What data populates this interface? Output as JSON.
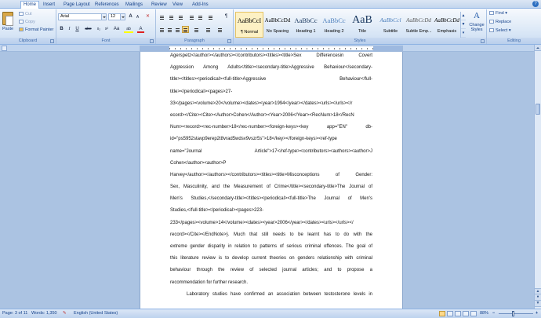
{
  "tabs": [
    "Home",
    "Insert",
    "Page Layout",
    "References",
    "Mailings",
    "Review",
    "View",
    "Add-Ins"
  ],
  "active_tab": "Home",
  "clipboard": {
    "paste": "Paste",
    "cut": "Cut",
    "copy": "Copy",
    "format_painter": "Format Painter",
    "label": "Clipboard"
  },
  "font": {
    "name": "Arial",
    "size": "12",
    "label": "Font",
    "bold": "B",
    "italic": "I",
    "underline": "U",
    "strikethrough": "abe",
    "subscript": "x₂",
    "superscript": "x²",
    "change_case": "Aa",
    "highlight": "ab",
    "font_color": "A",
    "grow": "A",
    "shrink": "A"
  },
  "paragraph": {
    "label": "Paragraph",
    "pilcrow": "¶"
  },
  "styles": {
    "label": "Styles",
    "items": [
      {
        "sample": "AaBbCcI",
        "name": "¶ Normal",
        "selected": true
      },
      {
        "sample": "AaBbCcDd",
        "name": "No Spacing",
        "selected": false
      },
      {
        "sample": "AaBbCc",
        "name": "Heading 1",
        "selected": false
      },
      {
        "sample": "AaBbCc",
        "name": "Heading 2",
        "selected": false
      },
      {
        "sample": "AaB",
        "name": "Title",
        "selected": false
      },
      {
        "sample": "AaBbCcl",
        "name": "Subtitle",
        "selected": false
      },
      {
        "sample": "AaBbCcDd",
        "name": "Subtle Emp...",
        "selected": false
      },
      {
        "sample": "AaBbCcDd",
        "name": "Emphasis",
        "selected": false
      }
    ],
    "change_styles": "Change Styles"
  },
  "editing": {
    "label": "Editing",
    "find": "Find",
    "replace": "Replace",
    "select": "Select"
  },
  "document_lines": [
    {
      "text": "Agerspetz</author></authors></contributors><titles><title>Sex Differencesin Covert",
      "justify": true
    },
    {
      "text": "Aggression Among Adults</title><secondary-title>Aggressive Behaviour</secondary-",
      "justify": true
    },
    {
      "text": "title></titles><periodical><full-title>Aggressive Behaviour</full-",
      "justify": true
    },
    {
      "text": "title></periodical><pages>27-",
      "justify": false
    },
    {
      "text": "33</pages><volume>20</volume><dates><year>1994</year></dates><urls></urls></r",
      "justify": true
    },
    {
      "text": "ecord></Cite><Cite><Author>Cohen</Author><Year>2006</Year><RecNum>18</RecN",
      "justify": true
    },
    {
      "text": "Num><record><rec-number>18</rec-number><foreign-keys><key app=\"EN\" db-",
      "justify": true
    },
    {
      "text": "id=\"ps5952stavp9erep2t8vrad5wdsv9vszr5s\">18</key></foreign-keys><ref-type",
      "justify": false
    },
    {
      "text": "name=\"Journal Article\">17</ref-type><contributors><authors><author>J",
      "justify": true
    },
    {
      "text": "Cohen</author><author>P",
      "justify": false
    },
    {
      "text": "Harvey</author></authors></contributors><titles><title>Misconceptions of Gender:",
      "justify": true
    },
    {
      "text": "Sex, Masculinity, and the Measurement of Crime</title><secondary-title>The Journal of",
      "justify": true
    },
    {
      "text": "Men's Studies,</secondary-title></titles><periodical><full-title>The Journal of Men's",
      "justify": true
    },
    {
      "text": "Studies,</full-title></periodical><pages>223-",
      "justify": false
    },
    {
      "text": "233</pages><volume>14</volume><dates><year>2006</year></dates><urls></urls></",
      "justify": true
    },
    {
      "text": "record></Cite></EndNote>}. Much that still needs to be learnt has to do with the",
      "justify": true
    },
    {
      "text": "extreme gender disparity in relation to patterns of serious criminal offences. The goal of",
      "justify": true
    },
    {
      "text": "this literature review is to develop current theories on genders relationship with criminal",
      "justify": true
    },
    {
      "text": "behaviour through the review of selected journal articles; and to propose a",
      "justify": true
    },
    {
      "text": "recommendation for further research.",
      "justify": false
    },
    {
      "text": "Laboratory studies have confirmed an association between testosterone levels in",
      "justify": true,
      "indent": true
    }
  ],
  "status": {
    "page": "Page: 3 of 11",
    "words": "Words: 1,350",
    "language": "English (United States)",
    "zoom": "88%",
    "zoom_fraction": 0.44
  }
}
